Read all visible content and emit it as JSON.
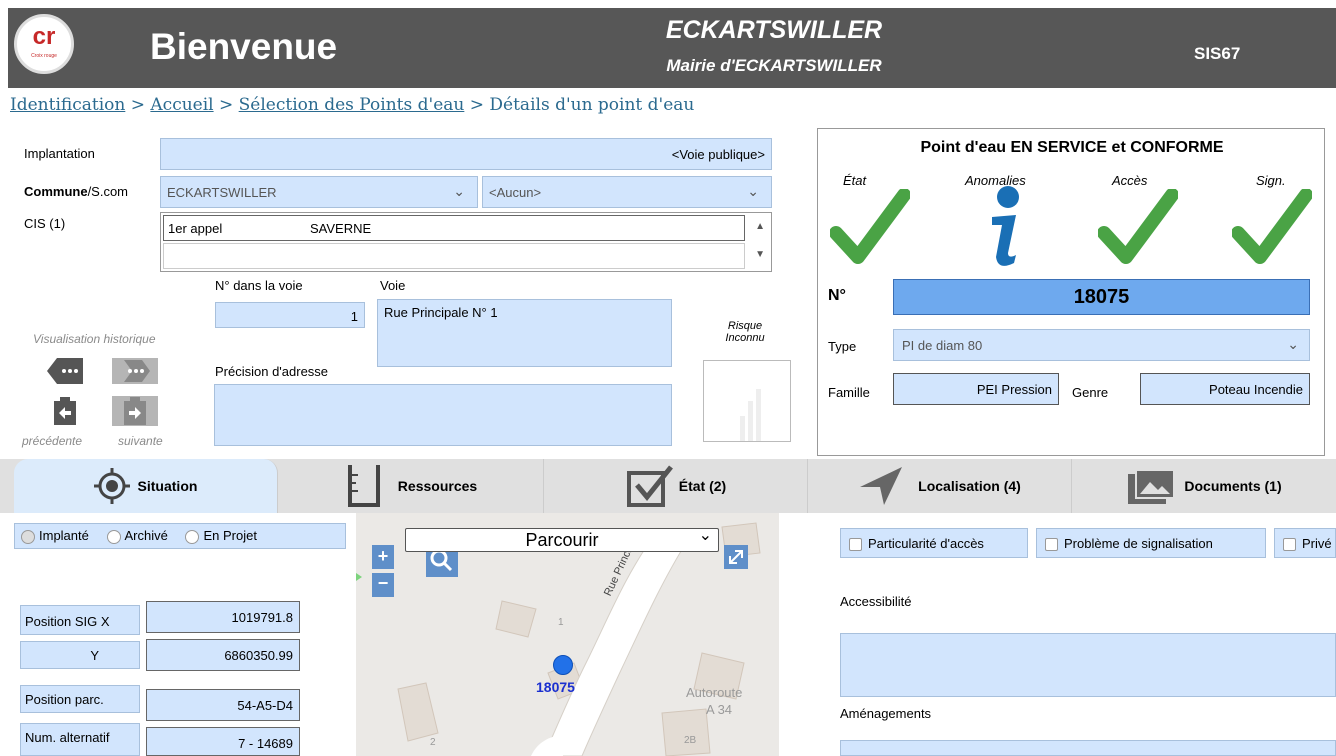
{
  "header": {
    "logo_text": "cr",
    "logo_sub": "Croix rouge",
    "welcome": "Bienvenue",
    "city": "ECKARTSWILLER",
    "mairie": "Mairie d'ECKARTSWILLER",
    "org": "SIS67"
  },
  "breadcrumb": {
    "items": [
      "Identification",
      "Accueil",
      "Sélection des Points d'eau"
    ],
    "sep": ">",
    "current": "Détails d'un point d'eau"
  },
  "form": {
    "implantation_label": "Implantation",
    "implantation_value": "<Voie publique>",
    "commune_label_bold": "Commune",
    "commune_label_rest": "/S.com",
    "commune_value": "ECKARTSWILLER",
    "scom_value": "<Aucun>",
    "cis_label": "CIS (1)",
    "cis_rank": "1er appel",
    "cis_name": "SAVERNE",
    "num_voie_label": "N° dans la voie",
    "num_voie_value": "1",
    "voie_label": "Voie",
    "voie_value": "Rue Principale N° 1",
    "risque_line1": "Risque",
    "risque_line2": "Inconnu",
    "precision_label": "Précision d'adresse",
    "precision_value": "",
    "historique_label": "Visualisation historique",
    "prev_label": "précédente",
    "next_label": "suivante"
  },
  "status": {
    "title": "Point d'eau EN SERVICE et CONFORME",
    "col_etat": "État",
    "col_anomalies": "Anomalies",
    "col_acces": "Accès",
    "col_sign": "Sign.",
    "num_label": "N°",
    "num_value": "18075",
    "type_label": "Type",
    "type_value": "PI de diam 80",
    "famille_label": "Famille",
    "famille_value": "PEI Pression",
    "genre_label": "Genre",
    "genre_value": "Poteau Incendie",
    "check_color": "#4aa345",
    "info_color": "#1a6fb5"
  },
  "tabs": [
    {
      "label": "Situation",
      "icon": "target-icon"
    },
    {
      "label": "Ressources",
      "icon": "beaker-icon"
    },
    {
      "label": "État (2)",
      "icon": "checkbox-icon"
    },
    {
      "label": "Localisation (4)",
      "icon": "navigation-arrow-icon"
    },
    {
      "label": "Documents (1)",
      "icon": "folder-image-icon"
    }
  ],
  "situation": {
    "radio_implante": "Implanté",
    "radio_archive": "Archivé",
    "radio_projet": "En Projet",
    "sig_x_label": "Position SIG X",
    "sig_x_value": "1019791.8",
    "sig_y_label": "Y",
    "sig_y_value": "6860350.99",
    "parc_label": "Position parc.",
    "parc_value": "54-A5-D4",
    "alt_label": "Num. alternatif",
    "alt_value": "7 - 14689"
  },
  "map": {
    "mode": "Parcourir",
    "street": "Rue Principale",
    "point_label": "18075",
    "autoroute_1": "Autoroute",
    "autoroute_2": "A 34",
    "bldg_1": "1",
    "bldg_2": "2",
    "bldg_2b": "2B"
  },
  "right": {
    "cb_acces": "Particularité d'accès",
    "cb_sign": "Problème de signalisation",
    "cb_priv": "Privé",
    "accessibilite_label": "Accessibilité",
    "amenagements_label": "Aménagements"
  }
}
